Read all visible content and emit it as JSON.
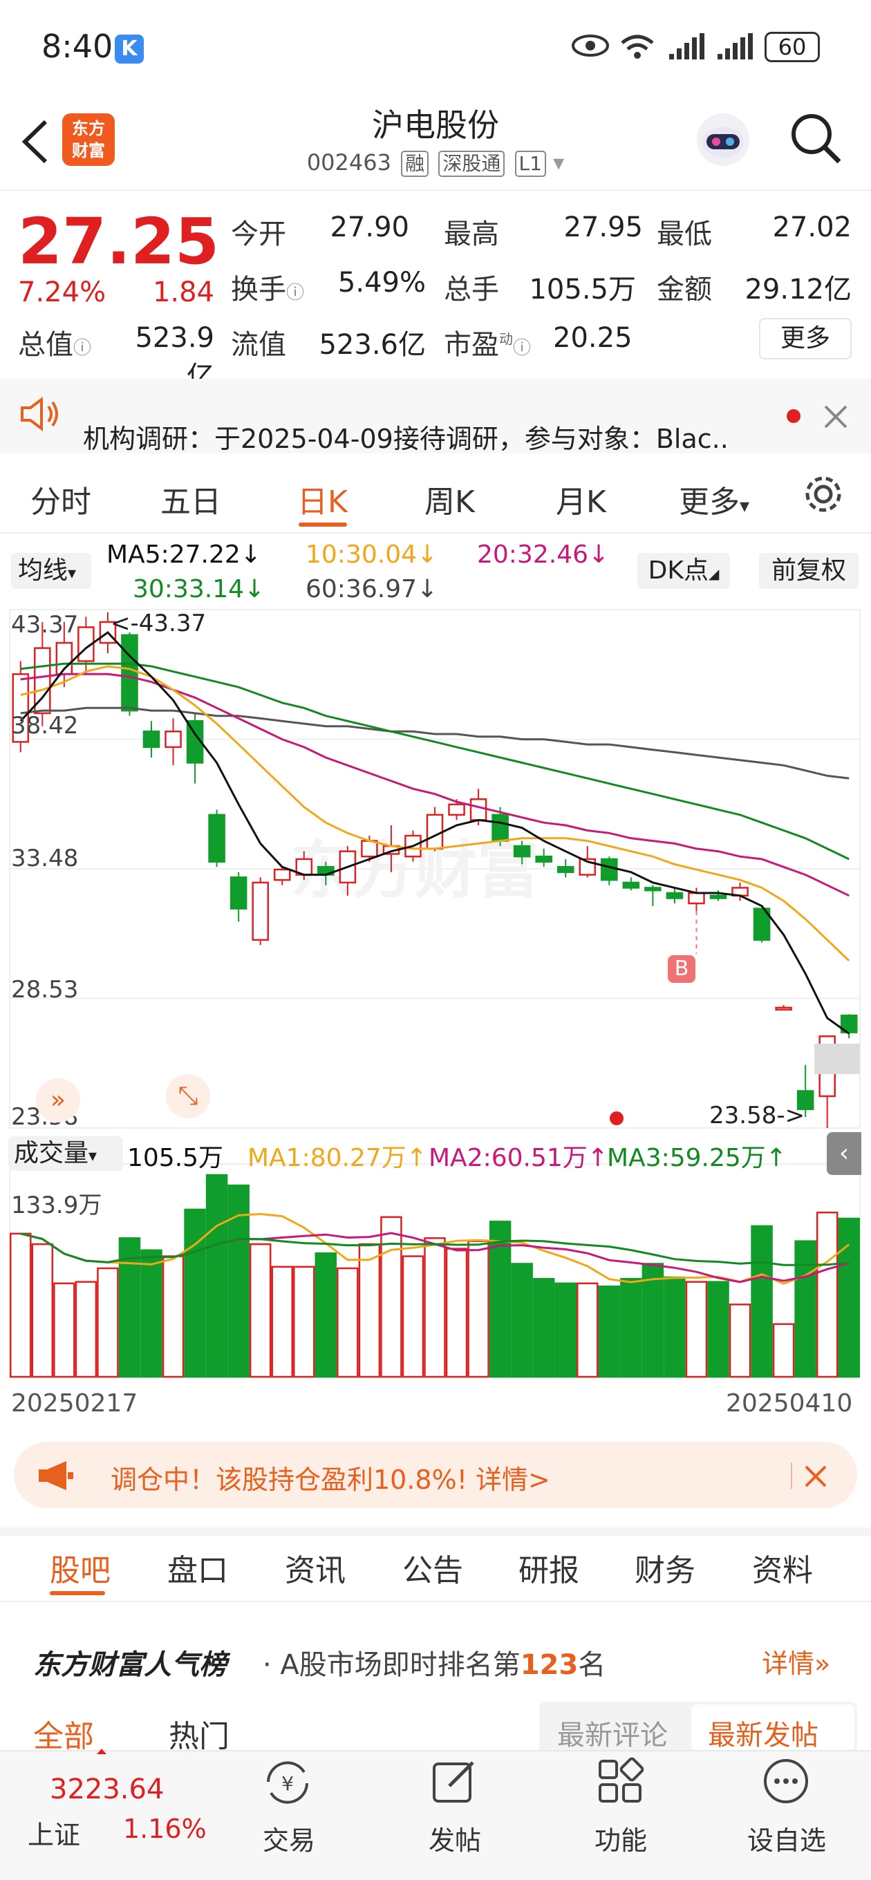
{
  "status_bar": {
    "time": "8:40",
    "k_badge": "K",
    "battery": "60"
  },
  "header": {
    "logo_line1": "东方",
    "logo_line2": "财富",
    "name": "沪电股份",
    "code": "002463",
    "tags": [
      "融",
      "深股通",
      "L1"
    ]
  },
  "quote": {
    "price": "27.25",
    "pct": "7.24%",
    "chg": "1.84",
    "open_label": "今开",
    "open": "27.90",
    "high_label": "最高",
    "high": "27.95",
    "low_label": "最低",
    "low": "27.02",
    "turnover_label": "换手",
    "turnover": "5.49%",
    "volume_label": "总手",
    "volume": "105.5万",
    "amount_label": "金额",
    "amount": "29.12亿",
    "mktcap_label": "总值",
    "mktcap": "523.9亿",
    "float_label": "流值",
    "float": "523.6亿",
    "pe_label": "市盈",
    "pe_sup": "动",
    "pe": "20.25",
    "more": "更多"
  },
  "banner": {
    "text": "机构调研：于2025-04-09接待调研，参与对象：Blac.."
  },
  "kline_tabs": {
    "items": [
      "分时",
      "五日",
      "日K",
      "周K",
      "月K",
      "更多"
    ],
    "active": "日K"
  },
  "ma_row": {
    "selector": "均线",
    "ma5": "MA5:27.22↓",
    "ma10": "10:30.04↓",
    "ma20": "20:32.46↓",
    "ma30": "30:33.14↓",
    "ma60": "60:36.97↓",
    "dk": "DK点",
    "fq": "前复权"
  },
  "price_axis": [
    "43.37",
    "38.42",
    "33.48",
    "28.53",
    "23.58"
  ],
  "annotations": {
    "high": "<-43.37",
    "low": "23.58->",
    "b_marker": "B"
  },
  "volume_row": {
    "selector": "成交量",
    "vol": "105.5万",
    "ma1": "MA1:80.27万↑",
    "ma2": "MA2:60.51万↑",
    "ma3": "MA3:59.25万↑",
    "axis_max": "133.9万"
  },
  "dates": {
    "start": "20250217",
    "end": "20250410"
  },
  "colors": {
    "up": "#e02020",
    "down": "#0f9d2b",
    "accent": "#e8601e",
    "ma5": "#111111",
    "ma10": "#f0a818",
    "ma20": "#c8187a",
    "ma30": "#118a22",
    "ma60": "#555555"
  },
  "chart_data": {
    "type": "candlestick",
    "price_range": [
      23.58,
      43.37
    ],
    "candles": [
      {
        "o": 38.4,
        "c": 41.0,
        "h": 41.5,
        "l": 38.0
      },
      {
        "o": 39.5,
        "c": 42.0,
        "h": 43.0,
        "l": 39.0
      },
      {
        "o": 41.0,
        "c": 42.2,
        "h": 43.0,
        "l": 40.5
      },
      {
        "o": 41.5,
        "c": 42.8,
        "h": 43.2,
        "l": 41.0
      },
      {
        "o": 42.2,
        "c": 43.0,
        "h": 43.37,
        "l": 41.8
      },
      {
        "o": 42.5,
        "c": 39.6,
        "h": 42.6,
        "l": 39.4
      },
      {
        "o": 38.8,
        "c": 38.2,
        "h": 39.2,
        "l": 37.8
      },
      {
        "o": 38.2,
        "c": 38.8,
        "h": 39.3,
        "l": 37.5
      },
      {
        "o": 39.2,
        "c": 37.6,
        "h": 39.5,
        "l": 36.8
      },
      {
        "o": 35.6,
        "c": 33.8,
        "h": 35.8,
        "l": 33.6
      },
      {
        "o": 33.2,
        "c": 32.0,
        "h": 33.4,
        "l": 31.5
      },
      {
        "o": 30.8,
        "c": 33.0,
        "h": 33.2,
        "l": 30.6
      },
      {
        "o": 33.1,
        "c": 33.5,
        "h": 33.6,
        "l": 32.9
      },
      {
        "o": 33.3,
        "c": 33.9,
        "h": 34.2,
        "l": 33.1
      },
      {
        "o": 33.6,
        "c": 33.3,
        "h": 33.8,
        "l": 32.9
      },
      {
        "o": 33.0,
        "c": 34.2,
        "h": 34.4,
        "l": 32.5
      },
      {
        "o": 34.0,
        "c": 34.6,
        "h": 34.8,
        "l": 33.8
      },
      {
        "o": 34.1,
        "c": 34.4,
        "h": 35.2,
        "l": 33.4
      },
      {
        "o": 34.0,
        "c": 34.8,
        "h": 35.0,
        "l": 33.8
      },
      {
        "o": 34.3,
        "c": 35.6,
        "h": 35.9,
        "l": 34.2
      },
      {
        "o": 35.6,
        "c": 36.0,
        "h": 36.2,
        "l": 35.4
      },
      {
        "o": 35.4,
        "c": 36.2,
        "h": 36.6,
        "l": 35.2
      },
      {
        "o": 35.6,
        "c": 34.6,
        "h": 35.9,
        "l": 34.4
      },
      {
        "o": 34.4,
        "c": 34.0,
        "h": 34.6,
        "l": 33.7
      },
      {
        "o": 34.0,
        "c": 33.8,
        "h": 34.3,
        "l": 33.6
      },
      {
        "o": 33.6,
        "c": 33.4,
        "h": 33.9,
        "l": 33.2
      },
      {
        "o": 33.3,
        "c": 33.9,
        "h": 34.4,
        "l": 33.2
      },
      {
        "o": 33.9,
        "c": 33.1,
        "h": 34.0,
        "l": 32.9
      },
      {
        "o": 33.0,
        "c": 32.8,
        "h": 33.2,
        "l": 32.7
      },
      {
        "o": 32.8,
        "c": 32.7,
        "h": 32.9,
        "l": 32.1
      },
      {
        "o": 32.6,
        "c": 32.4,
        "h": 32.8,
        "l": 32.2
      },
      {
        "o": 32.2,
        "c": 32.6,
        "h": 32.8,
        "l": 31.9
      },
      {
        "o": 32.5,
        "c": 32.4,
        "h": 32.7,
        "l": 32.3
      },
      {
        "o": 32.5,
        "c": 32.8,
        "h": 33.0,
        "l": 32.3
      },
      {
        "o": 32.0,
        "c": 30.8,
        "h": 32.0,
        "l": 30.7
      },
      {
        "o": 28.2,
        "c": 28.2,
        "h": 28.3,
        "l": 28.1
      },
      {
        "o": 25.0,
        "c": 24.3,
        "h": 26.0,
        "l": 24.0
      },
      {
        "o": 24.8,
        "c": 27.1,
        "h": 27.1,
        "l": 23.58
      },
      {
        "o": 27.9,
        "c": 27.25,
        "h": 27.95,
        "l": 27.02
      }
    ],
    "volumes": [
      95,
      88,
      62,
      63,
      72,
      92,
      84,
      80,
      111,
      133.9,
      127,
      88,
      73,
      73,
      82,
      72,
      88,
      106,
      80,
      92,
      85,
      90,
      103,
      75,
      65,
      62,
      62,
      60,
      65,
      75,
      66,
      63,
      63,
      48,
      100,
      35,
      90,
      109,
      105
    ],
    "ma5_line": [
      39.2,
      40.1,
      41.2,
      42.0,
      42.6,
      41.7,
      40.9,
      40.0,
      38.7,
      37.6,
      36.0,
      34.5,
      33.6,
      33.3,
      33.3,
      33.6,
      33.9,
      34.2,
      34.4,
      34.8,
      35.2,
      35.4,
      35.3,
      35.1,
      34.6,
      34.2,
      33.8,
      33.6,
      33.4,
      33.0,
      32.8,
      32.6,
      32.6,
      32.5,
      32.1,
      31.0,
      29.5,
      27.8,
      27.2
    ],
    "ma10_line": [
      40.2,
      40.4,
      40.7,
      41.1,
      41.3,
      41.2,
      40.9,
      40.4,
      39.8,
      39.1,
      38.3,
      37.5,
      36.7,
      35.9,
      35.3,
      34.9,
      34.6,
      34.4,
      34.3,
      34.3,
      34.4,
      34.5,
      34.6,
      34.7,
      34.7,
      34.7,
      34.6,
      34.4,
      34.2,
      34.0,
      33.7,
      33.5,
      33.3,
      33.1,
      32.8,
      32.3,
      31.6,
      30.8,
      30.0
    ],
    "ma20_line": [
      40.8,
      40.9,
      41.0,
      41.0,
      41.0,
      40.9,
      40.7,
      40.4,
      40.1,
      39.7,
      39.3,
      38.9,
      38.5,
      38.2,
      37.8,
      37.5,
      37.2,
      36.9,
      36.6,
      36.4,
      36.1,
      35.9,
      35.7,
      35.5,
      35.3,
      35.2,
      35.0,
      34.9,
      34.7,
      34.6,
      34.5,
      34.3,
      34.2,
      34.0,
      33.9,
      33.6,
      33.3,
      32.9,
      32.5
    ],
    "ma30_line": [
      41.2,
      41.3,
      41.4,
      41.4,
      41.4,
      41.4,
      41.3,
      41.1,
      40.9,
      40.7,
      40.5,
      40.2,
      39.9,
      39.7,
      39.4,
      39.2,
      39.0,
      38.8,
      38.6,
      38.4,
      38.2,
      38.0,
      37.8,
      37.6,
      37.4,
      37.2,
      37.0,
      36.8,
      36.6,
      36.4,
      36.2,
      36.0,
      35.8,
      35.6,
      35.3,
      35.0,
      34.7,
      34.3,
      33.9
    ],
    "ma60_line": [
      39.5,
      39.6,
      39.6,
      39.7,
      39.7,
      39.7,
      39.6,
      39.6,
      39.5,
      39.4,
      39.4,
      39.3,
      39.2,
      39.1,
      39.0,
      39.0,
      38.9,
      38.8,
      38.8,
      38.7,
      38.7,
      38.6,
      38.6,
      38.5,
      38.5,
      38.4,
      38.3,
      38.3,
      38.2,
      38.1,
      38.0,
      37.9,
      37.8,
      37.7,
      37.6,
      37.5,
      37.3,
      37.1,
      37.0
    ]
  },
  "notice": {
    "text": "调仓中！该股持仓盈利10.8%! 详情>"
  },
  "bottom_tabs": {
    "items": [
      "股吧",
      "盘口",
      "资讯",
      "公告",
      "研报",
      "财务",
      "资料"
    ],
    "active": "股吧"
  },
  "ranking": {
    "brand": "东方财富人气榜",
    "text_pre": "· A股市场即时排名第",
    "rank": "123",
    "text_post": "名",
    "detail": "详情"
  },
  "sub_tabs": {
    "all": "全部",
    "hot": "热门",
    "latest_comment": "最新评论",
    "latest_post": "最新发帖"
  },
  "nav": {
    "index_value": "3223.64",
    "index_name": "上证",
    "index_pct": "1.16%",
    "trade": "交易",
    "post": "发帖",
    "function": "功能",
    "watchlist": "设自选"
  }
}
